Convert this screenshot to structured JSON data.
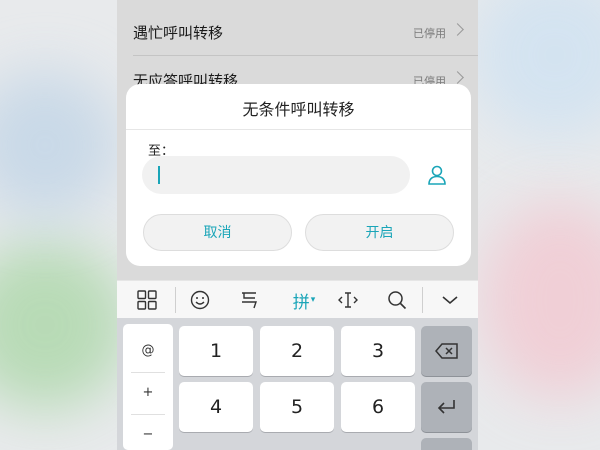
{
  "settings": {
    "items": [
      {
        "label": "遇忙呼叫转移",
        "status": "已停用"
      },
      {
        "label": "无应答呼叫转移",
        "status": "已停用"
      }
    ]
  },
  "dialog": {
    "title": "无条件呼叫转移",
    "to_label": "至：",
    "input_value": "",
    "cancel_label": "取消",
    "confirm_label": "开启"
  },
  "keyboard": {
    "toolbar": {
      "pinyin_label": "拼"
    },
    "side_keys": [
      "@",
      "+",
      "−"
    ],
    "digit_rows": [
      [
        "1",
        "2",
        "3"
      ],
      [
        "4",
        "5",
        "6"
      ]
    ]
  },
  "colors": {
    "accent": "#1aa5b8",
    "dim_overlay": "#dadada",
    "keyboard_bg": "#d4d6da"
  },
  "icons": [
    "chevron-right-icon",
    "person-icon",
    "grid-icon",
    "emoji-icon",
    "handwriting-icon",
    "cursor-icon",
    "search-icon",
    "collapse-keyboard-icon",
    "backspace-icon",
    "enter-icon"
  ]
}
